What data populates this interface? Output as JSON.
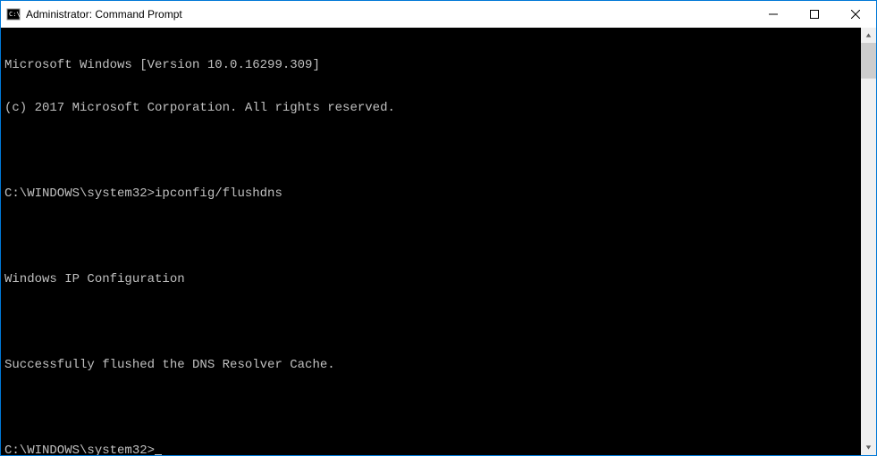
{
  "window": {
    "title": "Administrator: Command Prompt"
  },
  "terminal": {
    "lines": [
      "Microsoft Windows [Version 10.0.16299.309]",
      "(c) 2017 Microsoft Corporation. All rights reserved.",
      "",
      "C:\\WINDOWS\\system32>ipconfig/flushdns",
      "",
      "Windows IP Configuration",
      "",
      "Successfully flushed the DNS Resolver Cache.",
      ""
    ],
    "prompt": "C:\\WINDOWS\\system32>"
  }
}
